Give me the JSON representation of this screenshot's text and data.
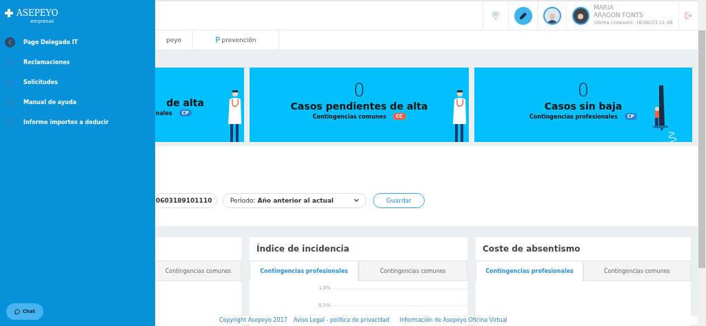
{
  "sidebar": {
    "logo": {
      "name": "ASEPEYO",
      "sub": "empresas"
    },
    "back_item": {
      "label": "Pago Delegado IT"
    },
    "items": [
      {
        "label": "Reclamaciones",
        "kind": "list"
      },
      {
        "label": "Solicitudes",
        "kind": "list"
      },
      {
        "label": "Manual de ayuda",
        "kind": "external"
      },
      {
        "label": "Informe importes a deducir",
        "kind": "external"
      }
    ],
    "chat_button": "Chat"
  },
  "header": {
    "user": {
      "name": "MARIA",
      "surname": "ARAGON FONTS",
      "last_login": "Última conexión: 16/06/23 11:46"
    }
  },
  "tabs": [
    {
      "label": "peyo",
      "kind": "plain"
    },
    {
      "label": "prevención",
      "kind": "brand"
    }
  ],
  "cards": [
    {
      "title": "de alta",
      "subtitle": "nales",
      "badge": "CP",
      "color": "#2a7fd4",
      "kind": "doctor"
    },
    {
      "number": "0",
      "title": "Casos pendientes de alta",
      "subtitle": "Contingencias comunes",
      "badge": "CC",
      "color": "#f0614a",
      "kind": "doctor"
    },
    {
      "number": "0",
      "title": "Casos sin baja",
      "subtitle": "Contingencias profesionales",
      "badge": "CP",
      "color": "#2a7fd4",
      "kind": "pen"
    }
  ],
  "filters": {
    "company": {
      "value": "0603189101110"
    },
    "period": {
      "label": "Periodo:",
      "value": "Año anterior al actual"
    },
    "save_button": "Guardar"
  },
  "panels": [
    {
      "tabs": [
        {
          "label": "Contingencias comunes",
          "selected": false
        }
      ]
    },
    {
      "title": "Índice de incidencia",
      "tabs": [
        {
          "label": "Contingencias profesionales",
          "selected": true
        },
        {
          "label": "Contingencias comunes",
          "selected": false
        }
      ],
      "axis_labels": [
        "1.0%",
        "0.5%"
      ]
    },
    {
      "title": "Coste de absentismo",
      "tabs": [
        {
          "label": "Contingencias profesionales",
          "selected": true
        },
        {
          "label": "Contingencias comunes",
          "selected": false
        }
      ]
    }
  ],
  "footer": [
    "Copyright Asepeyo 2017",
    "Aviso Legal - política de privacidad",
    "Información de Asepeyo Oficina Virtual"
  ]
}
